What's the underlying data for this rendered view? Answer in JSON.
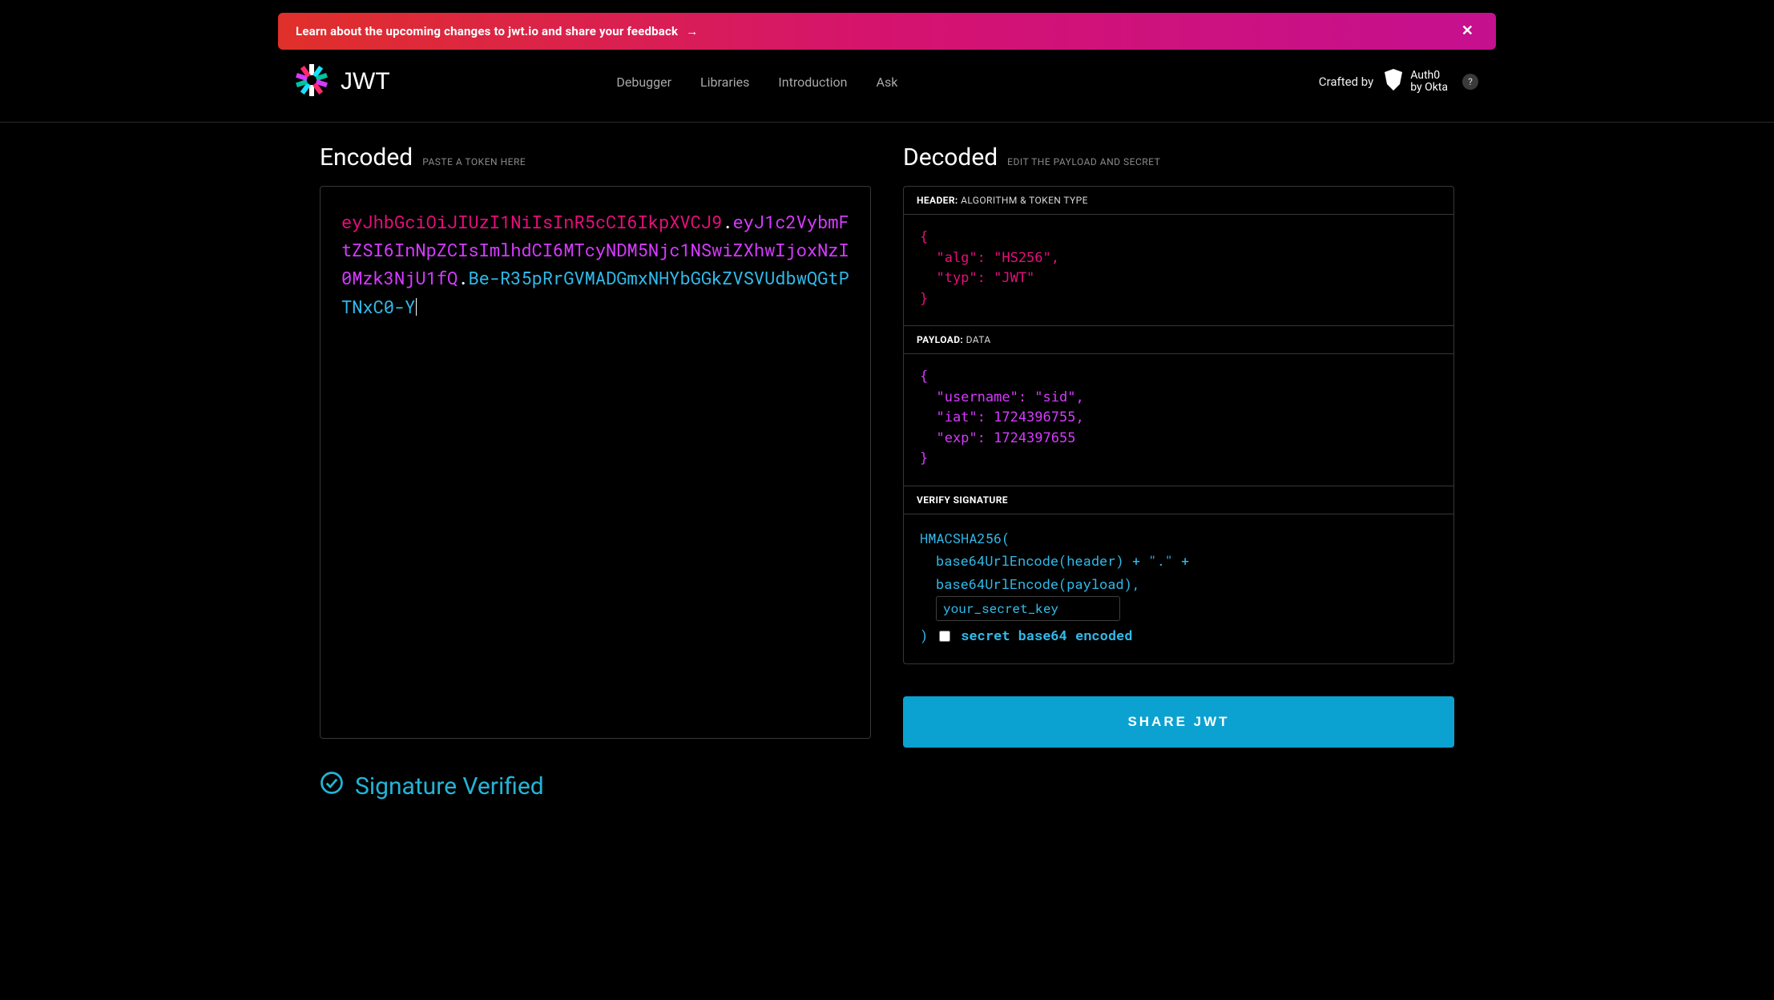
{
  "banner": {
    "text": "Learn about the upcoming changes to jwt.io and share your feedback",
    "arrow": "→",
    "close": "✕"
  },
  "brand": {
    "word": "J ⌵ T",
    "logo_title": "JWT"
  },
  "nav": {
    "debugger": "Debugger",
    "libraries": "Libraries",
    "introduction": "Introduction",
    "ask": "Ask"
  },
  "crafted": {
    "label": "Crafted by",
    "auth0_line1": "Auth0",
    "auth0_line2": "by Okta",
    "help": "?"
  },
  "encoded": {
    "title": "Encoded",
    "sub": "PASTE A TOKEN HERE",
    "token_header": "eyJhbGciOiJIUzI1NiIsInR5cCI6IkpXVCJ9",
    "token_payload": "eyJ1c2VybmFtZSI6InNpZCIsImlhdCI6MTcyNDM5Njc1NSwiZXhwIjoxNzI0Mzk3NjU1fQ",
    "token_sig": "Be-R35pRrGVMADGmxNHYbGGkZVSVUdbwQGtPTNxC0-Y",
    "dot": "."
  },
  "decoded": {
    "title": "Decoded",
    "sub": "EDIT THE PAYLOAD AND SECRET",
    "header_label": "HEADER:",
    "header_desc": "ALGORITHM & TOKEN TYPE",
    "header_json": "{\n  \"alg\": \"HS256\",\n  \"typ\": \"JWT\"\n}",
    "payload_label": "PAYLOAD:",
    "payload_desc": "DATA",
    "payload_json": "{\n  \"username\": \"sid\",\n  \"iat\": 1724396755,\n  \"exp\": 1724397655\n}",
    "verify_label": "VERIFY SIGNATURE",
    "verify": {
      "line1": "HMACSHA256(",
      "line2": "base64UrlEncode(header) + \".\" +",
      "line3": "base64UrlEncode(payload),",
      "secret_value": "your_secret_key",
      "close_paren": ")",
      "base64_label": "secret base64 encoded",
      "base64_checked": false
    }
  },
  "signature_status": "Signature Verified",
  "share_btn": "SHARE JWT"
}
